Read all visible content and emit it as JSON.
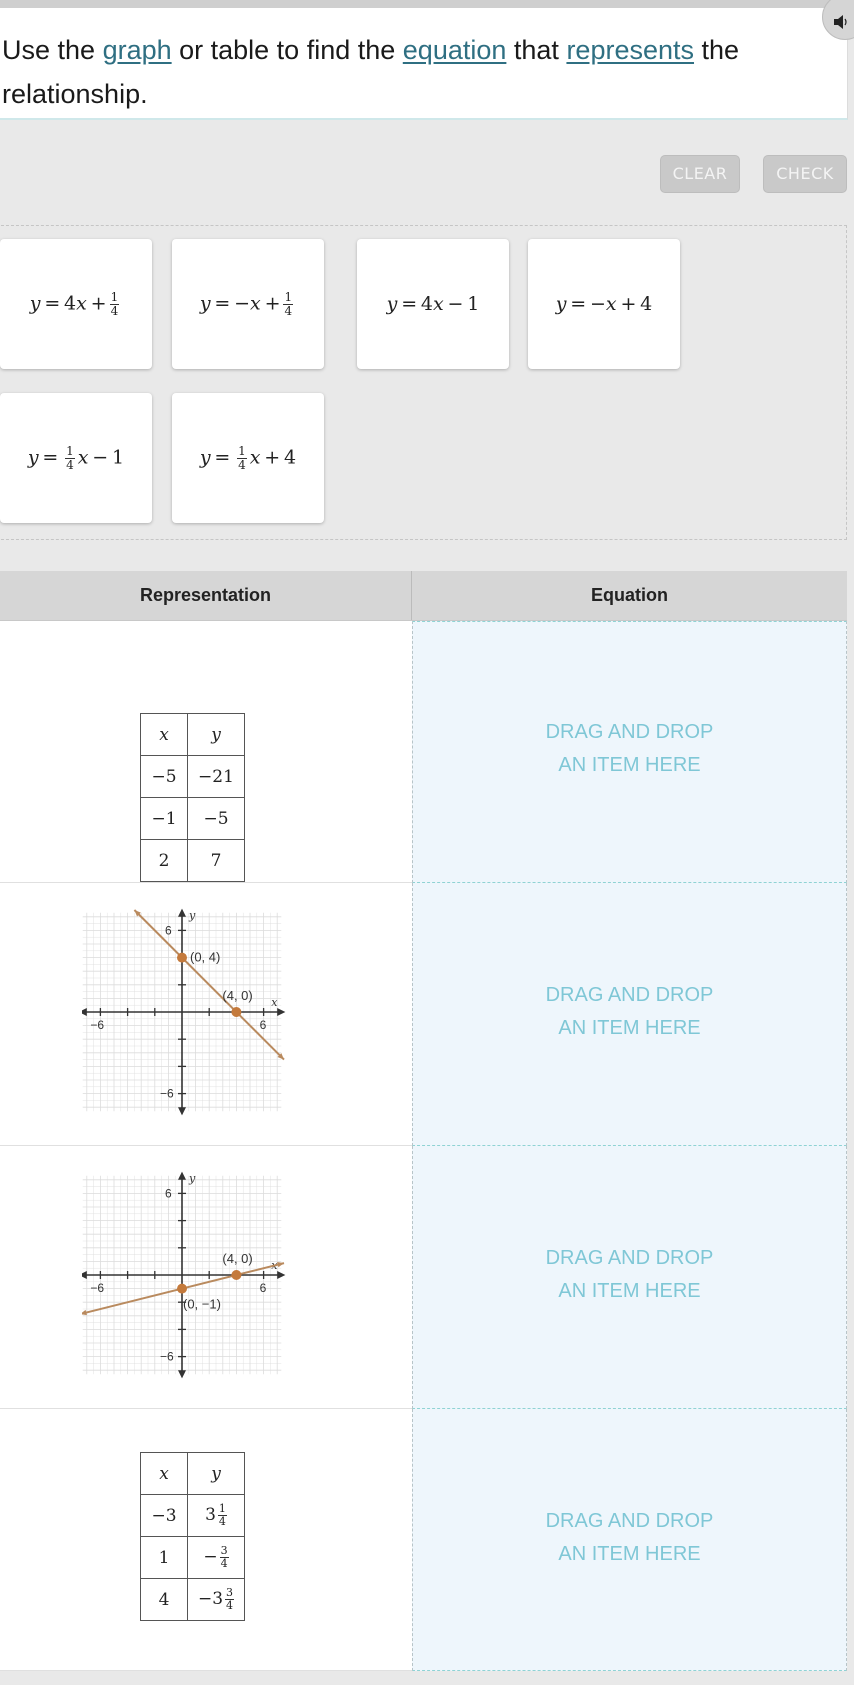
{
  "prompt": {
    "parts": [
      {
        "text": "Use the ",
        "link": false
      },
      {
        "text": "graph",
        "link": true
      },
      {
        "text": " or table to find the ",
        "link": false
      },
      {
        "text": "equation",
        "link": true
      },
      {
        "text": " that ",
        "link": false
      },
      {
        "text": "represents",
        "link": true
      },
      {
        "text": " the relationship.",
        "link": false
      }
    ],
    "speaker_icon": "speaker-icon"
  },
  "toolbar": {
    "clear_label": "CLEAR",
    "check_label": "CHECK"
  },
  "colors": {
    "accent_link": "#2f6f82",
    "drop_text": "#7fc7d6",
    "drop_bg": "#eef6fc",
    "line": "#b98a5e",
    "point": "#c47a3c"
  },
  "bank": {
    "cards": [
      {
        "id": "c1",
        "lhs": "y",
        "rhs_pre": "4x +",
        "frac": [
          "1",
          "4"
        ],
        "rhs_post": ""
      },
      {
        "id": "c2",
        "lhs": "y",
        "rhs_pre": "−x +",
        "frac": [
          "1",
          "4"
        ],
        "rhs_post": ""
      },
      {
        "id": "c3",
        "lhs": "y",
        "rhs_pre": "4x − 1",
        "frac": null,
        "rhs_post": ""
      },
      {
        "id": "c4",
        "lhs": "y",
        "rhs_pre": "−x + 4",
        "frac": null,
        "rhs_post": ""
      },
      {
        "id": "c5",
        "lhs": "y",
        "rhs_pre": "",
        "frac": [
          "1",
          "4"
        ],
        "rhs_post": "x − 1"
      },
      {
        "id": "c6",
        "lhs": "y",
        "rhs_pre": "",
        "frac": [
          "1",
          "4"
        ],
        "rhs_post": "x + 4"
      }
    ]
  },
  "table": {
    "headers": {
      "representation": "Representation",
      "equation": "Equation"
    },
    "drop_placeholder": [
      "DRAG AND DROP",
      "AN ITEM HERE"
    ],
    "rows": [
      {
        "type": "table",
        "col_headers": [
          "x",
          "y"
        ],
        "values": [
          [
            "−5",
            "−21"
          ],
          [
            "−1",
            "−5"
          ],
          [
            "2",
            "7"
          ]
        ]
      },
      {
        "type": "graph",
        "axis_labels": {
          "x": "x",
          "y": "y"
        },
        "tick_labels": {
          "x_neg": "−6",
          "x_pos": "6",
          "y_pos": "6",
          "y_neg": "−6"
        },
        "points": [
          {
            "x": 0,
            "y": 4,
            "label": "(0, 4)"
          },
          {
            "x": 4,
            "y": 0,
            "label": "(4, 0)"
          }
        ],
        "range": [
          -7,
          7
        ]
      },
      {
        "type": "graph",
        "axis_labels": {
          "x": "x",
          "y": "y"
        },
        "tick_labels": {
          "x_neg": "−6",
          "x_pos": "6",
          "y_pos": "6",
          "y_neg": "−6"
        },
        "points": [
          {
            "x": 4,
            "y": 0,
            "label": "(4, 0)"
          },
          {
            "x": 0,
            "y": -1,
            "label": "(0, −1)"
          }
        ],
        "range": [
          -7,
          7
        ]
      },
      {
        "type": "table",
        "col_headers": [
          "x",
          "y"
        ],
        "values": [
          [
            {
              "whole": "−3"
            },
            {
              "whole": "3",
              "frac": [
                "1",
                "4"
              ]
            }
          ],
          [
            {
              "whole": "1"
            },
            {
              "whole": "−",
              "frac": [
                "3",
                "4"
              ]
            }
          ],
          [
            {
              "whole": "4"
            },
            {
              "whole": "−3",
              "frac": [
                "3",
                "4"
              ]
            }
          ]
        ]
      }
    ]
  }
}
